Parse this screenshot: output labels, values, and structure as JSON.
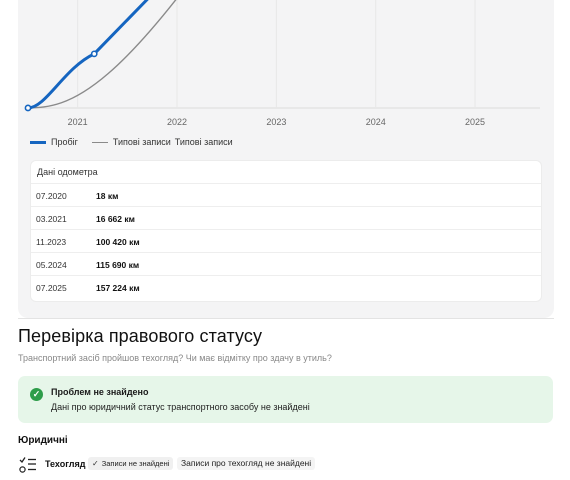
{
  "chart_data": {
    "type": "line",
    "x_ticks": [
      "2021",
      "2022",
      "2023",
      "2024",
      "2025"
    ],
    "xlim": [
      "2020-07",
      "2025-08"
    ],
    "series": [
      {
        "name": "Пробіг",
        "color": "#1565c0",
        "points": [
          [
            "2020-07",
            18
          ],
          [
            "2021-03",
            16662
          ],
          [
            "2023-11",
            100420
          ],
          [
            "2024-05",
            115690
          ],
          [
            "2025-07",
            157224
          ]
        ]
      },
      {
        "name": "Типові записи",
        "color": "#8a8a8a",
        "points": [
          [
            "2020-07",
            18
          ],
          [
            "2025-07",
            157224
          ]
        ]
      }
    ],
    "grid": true
  },
  "legend": {
    "mileage": "Пробіг",
    "typical": "Типові записи",
    "typical_extra": "Типові записи"
  },
  "odometer": {
    "title": "Дані одометра",
    "rows": [
      {
        "date": "07.2020",
        "value": "18 км"
      },
      {
        "date": "03.2021",
        "value": "16 662 км"
      },
      {
        "date": "11.2023",
        "value": "100 420 км"
      },
      {
        "date": "05.2024",
        "value": "115 690 км"
      },
      {
        "date": "07.2025",
        "value": "157 224 км"
      }
    ]
  },
  "legal": {
    "title": "Перевірка правового статусу",
    "subtitle": "Транспортний засіб пройшов техогляд? Чи має відмітку про здачу в утиль?",
    "alert_title": "Проблем не знайдено",
    "alert_text": "Дані про юридичний статус транспортного засобу не знайдені",
    "section": "Юридичні",
    "item_title": "Техогляд",
    "chip": "Записи не знайдені",
    "item_desc": "Записи про техогляд не знайдені"
  },
  "colors": {
    "accent": "#1565c0",
    "success": "#2e9d4a",
    "success_bg": "#e6f6e9"
  }
}
